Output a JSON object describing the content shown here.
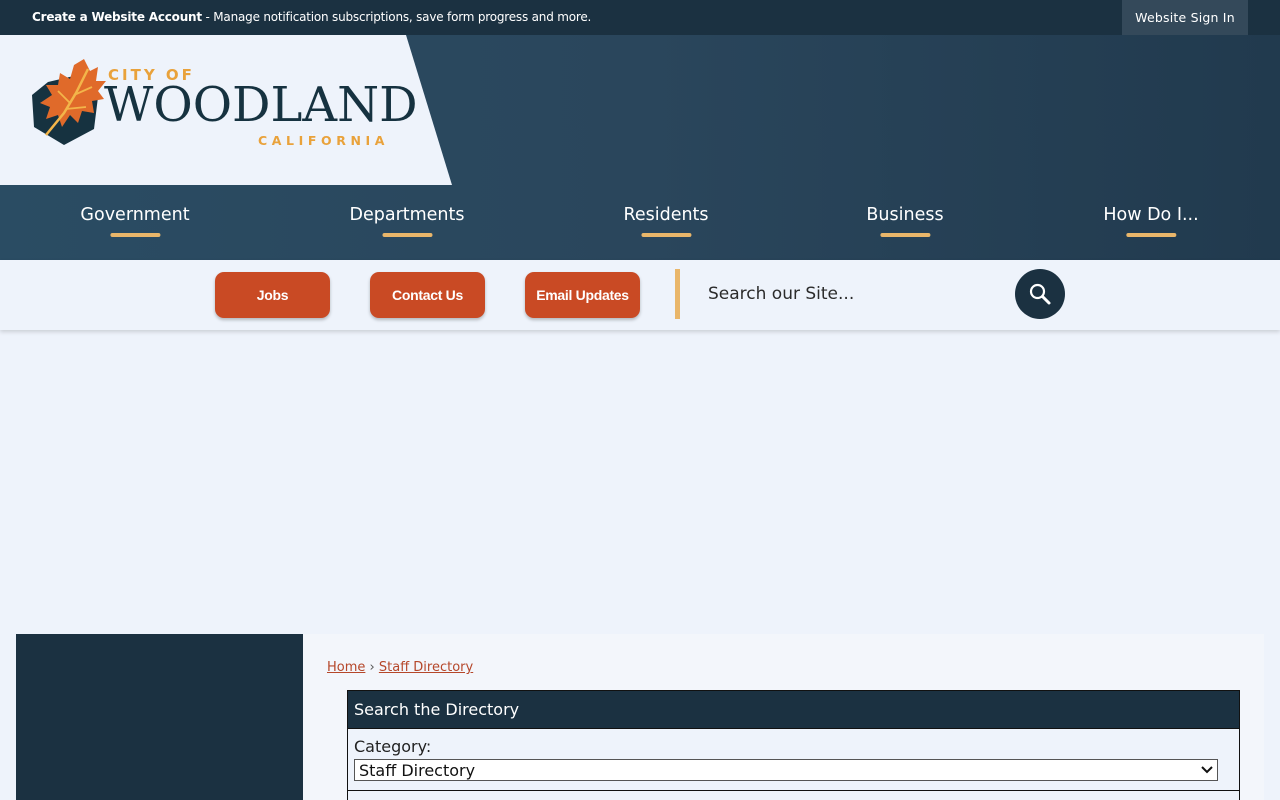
{
  "topbar": {
    "account_link": "Create a Website Account",
    "account_desc": " - Manage notification subscriptions, save form progress and more.",
    "sign_in": "Website Sign In"
  },
  "logo": {
    "city_of": "CITY OF",
    "name": "WOODLAND",
    "state": "CALIFORNIA",
    "colors": {
      "orange": "#e9a23b",
      "navy": "#163240",
      "leaf": "#e06a2a"
    }
  },
  "nav": {
    "items": [
      {
        "label": "Government"
      },
      {
        "label": "Departments"
      },
      {
        "label": "Residents"
      },
      {
        "label": "Business"
      },
      {
        "label": "How Do I..."
      }
    ]
  },
  "quicklinks": {
    "buttons": [
      {
        "label": "Jobs"
      },
      {
        "label": "Contact Us"
      },
      {
        "label": "Email Updates"
      }
    ],
    "search_placeholder": "Search our Site...",
    "search_icon": "magnifier-icon"
  },
  "breadcrumb": {
    "home": "Home",
    "separator": "›",
    "current": "Staff Directory"
  },
  "directory": {
    "heading": "Search the Directory",
    "category_label": "Category:",
    "category_value": "Staff Directory"
  },
  "colors": {
    "dark_navy": "#1b3141",
    "button_orange": "#c94a24",
    "accent_gold": "#e9b66a",
    "page_bg": "#eef3fb"
  }
}
